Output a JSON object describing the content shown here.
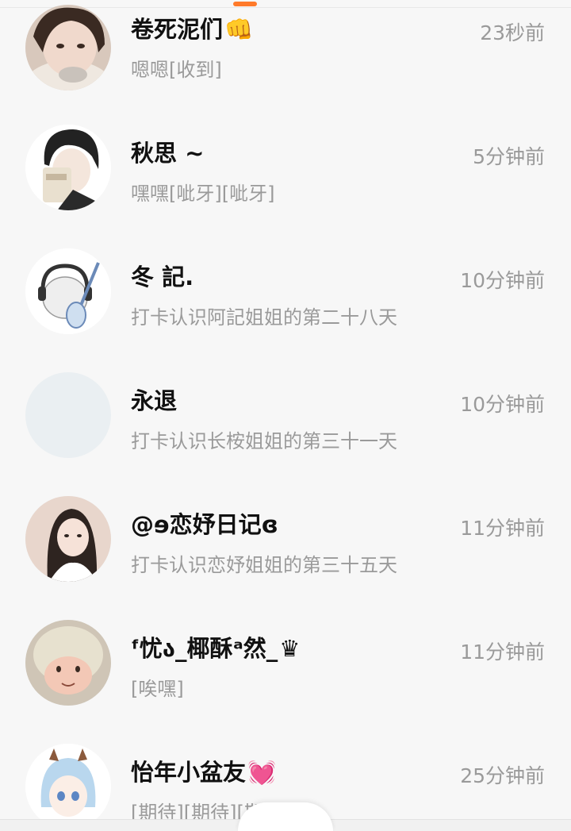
{
  "conversations": [
    {
      "name": "卷死泥们",
      "name_emoji": "👊",
      "time": "23秒前",
      "message": "嗯嗯[收到]",
      "avatar": "photo-girl-avatar"
    },
    {
      "name": "秋思 ~",
      "name_emoji": "",
      "time": "5分钟前",
      "message": "嘿嘿[呲牙][呲牙]",
      "avatar": "anime-boy-avatar"
    },
    {
      "name": "冬 記.",
      "name_emoji": "",
      "time": "10分钟前",
      "message": "打卡认识阿記姐姐的第二十八天",
      "avatar": "sheep-guitar-avatar"
    },
    {
      "name": "永退",
      "name_emoji": "",
      "time": "10分钟前",
      "message": "打卡认识长桉姐姐的第三十一天",
      "avatar": "blank-avatar"
    },
    {
      "name": "@ɘ恋妤日记ɞ",
      "name_emoji": "",
      "time": "11分钟前",
      "message": "打卡认识恋妤姐姐的第三十五天",
      "avatar": "photo-girl2-avatar"
    },
    {
      "name": "ᶠ忧ა_椰酥ᵃ然_",
      "name_emoji": "♛",
      "time": "11分钟前",
      "message": "[唉嘿]",
      "avatar": "plush-lamb-avatar"
    },
    {
      "name": "怡年小盆友",
      "name_emoji": "💓",
      "time": "25分钟前",
      "message": "[期待][期待][期",
      "avatar": "anime-girl-avatar"
    }
  ],
  "colors": {
    "accent": "#ff7a2a",
    "background": "#f7f7f7",
    "name_text": "#111111",
    "secondary_text": "#9a9a9a"
  }
}
